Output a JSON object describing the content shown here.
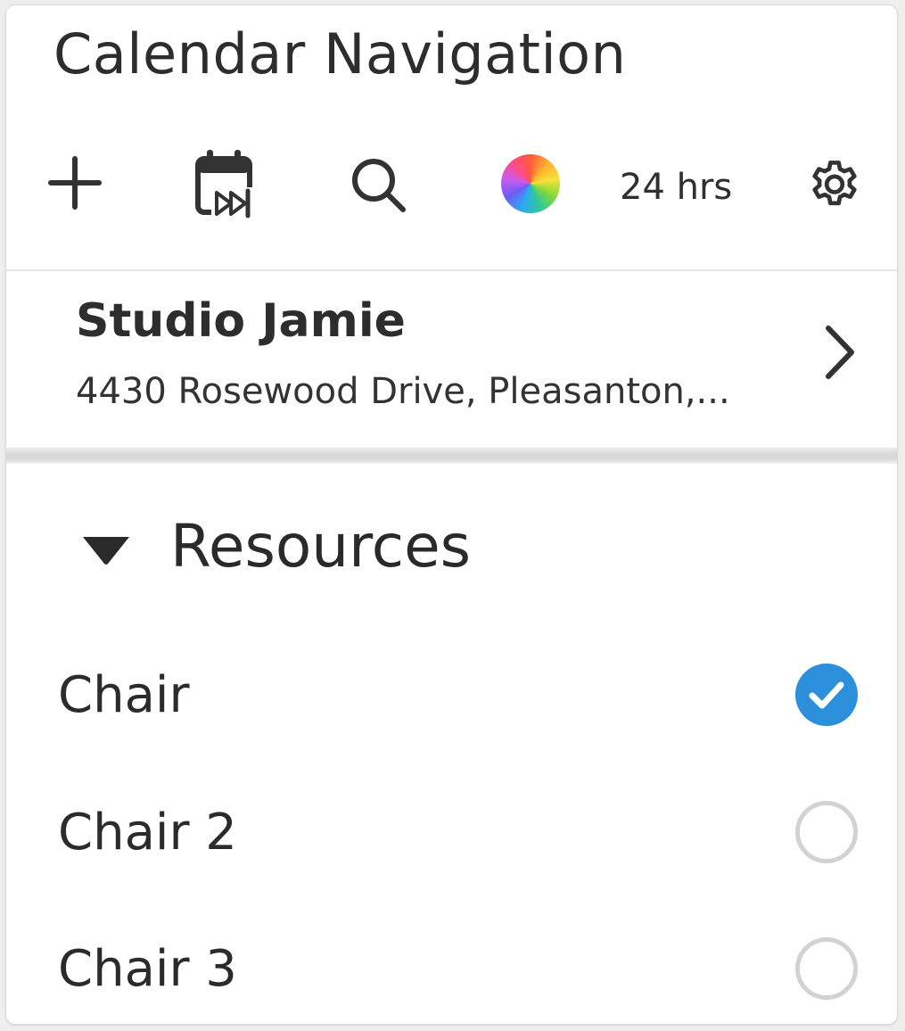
{
  "panel": {
    "title": "Calendar Navigation"
  },
  "toolbar": {
    "add_icon": "plus-icon",
    "today_icon": "calendar-skip-forward-icon",
    "search_icon": "search-icon",
    "color_icon": "color-wheel-icon",
    "hours_label": "24 hrs",
    "settings_icon": "gear-icon"
  },
  "location": {
    "name": "Studio Jamie",
    "address": "4430 Rosewood Drive, Pleasanton,...",
    "chevron_icon": "chevron-right-icon"
  },
  "resources": {
    "title": "Resources",
    "expanded": true,
    "items": [
      {
        "label": "Chair",
        "selected": true
      },
      {
        "label": "Chair 2",
        "selected": false
      },
      {
        "label": "Chair 3",
        "selected": false
      }
    ]
  },
  "colors": {
    "accent": "#2b8fdc",
    "text": "#2b2b2b",
    "unchecked_ring": "#d2d2d2"
  }
}
